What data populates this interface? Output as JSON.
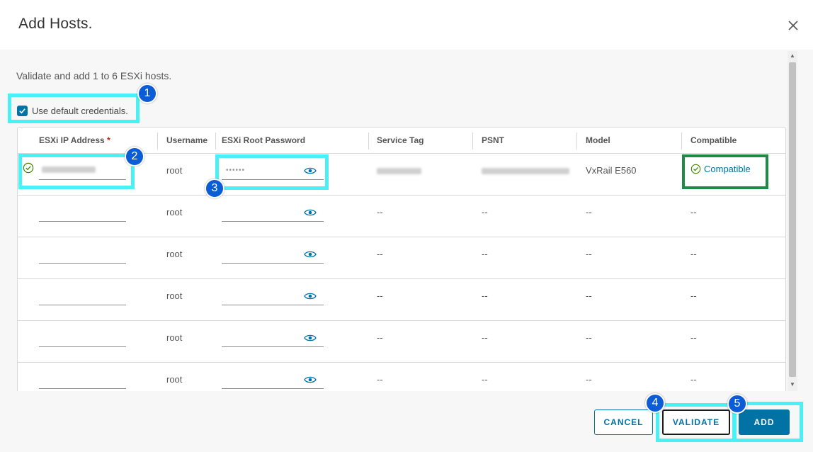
{
  "dialog": {
    "title": "Add Hosts.",
    "description": "Validate and add 1 to 6 ESXi hosts.",
    "use_default_credentials": {
      "label": "Use default credentials.",
      "checked": true
    }
  },
  "table": {
    "columns": [
      {
        "key": "ip",
        "label": "ESXi IP Address",
        "required": "*"
      },
      {
        "key": "username",
        "label": "Username"
      },
      {
        "key": "password",
        "label": "ESXi Root Password"
      },
      {
        "key": "service_tag",
        "label": "Service Tag"
      },
      {
        "key": "psnt",
        "label": "PSNT"
      },
      {
        "key": "model",
        "label": "Model"
      },
      {
        "key": "compatible",
        "label": "Compatible"
      }
    ],
    "rows": [
      {
        "username": "root",
        "password_mask": "••••••",
        "service_tag": "",
        "psnt": "",
        "model": "VxRail E560",
        "compatible": "Compatible",
        "validated": true
      },
      {
        "username": "root",
        "password_mask": "",
        "service_tag": "--",
        "psnt": "--",
        "model": "--",
        "compatible": "--",
        "validated": false
      },
      {
        "username": "root",
        "password_mask": "",
        "service_tag": "--",
        "psnt": "--",
        "model": "--",
        "compatible": "--",
        "validated": false
      },
      {
        "username": "root",
        "password_mask": "",
        "service_tag": "--",
        "psnt": "--",
        "model": "--",
        "compatible": "--",
        "validated": false
      },
      {
        "username": "root",
        "password_mask": "",
        "service_tag": "--",
        "psnt": "--",
        "model": "--",
        "compatible": "--",
        "validated": false
      },
      {
        "username": "root",
        "password_mask": "",
        "service_tag": "--",
        "psnt": "--",
        "model": "--",
        "compatible": "--",
        "validated": false
      }
    ]
  },
  "footer": {
    "cancel_label": "CANCEL",
    "validate_label": "VALIDATE",
    "add_label": "ADD"
  },
  "callouts": [
    "1",
    "2",
    "3",
    "4",
    "5"
  ],
  "colors": {
    "accent": "#0072a3",
    "callout": "#0b5cd5",
    "highlight": "#4af0f5",
    "compatible_box": "#1e8b45",
    "success": "#3c8500"
  },
  "icons": {
    "close": "close-icon",
    "check": "checkmark-icon",
    "eye": "eye-icon",
    "success": "check-circle-icon"
  }
}
